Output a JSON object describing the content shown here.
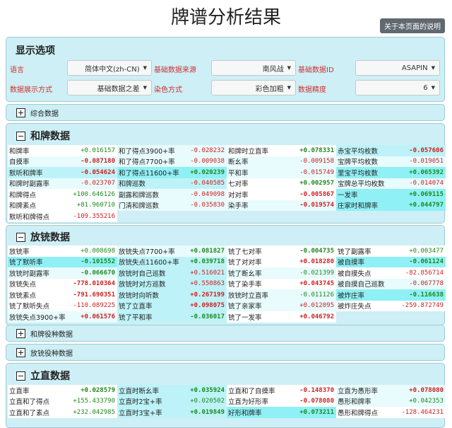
{
  "title": "牌谱分析结果",
  "help_button": "关于本页面的说明",
  "options": {
    "header": "显示选项",
    "rows": [
      [
        {
          "label": "语言",
          "value": "简体中文(zh-CN)"
        },
        {
          "label": "基础数据来源",
          "value": "南风战"
        },
        {
          "label": "基础数据ID",
          "value": "ASAPIN"
        }
      ],
      [
        {
          "label": "数据展示方式",
          "value": "基础数据之差"
        },
        {
          "label": "染色方式",
          "value": "彩色加粗"
        },
        {
          "label": "数据精度",
          "value": "6"
        }
      ]
    ]
  },
  "collapsed": {
    "composite": "综合数据",
    "hule_dealer": "和牌役种数据",
    "fangchong_dealer": "放铳役种数据"
  },
  "sections": {
    "hule": {
      "header": "和牌数据",
      "rows": [
        [
          [
            "和牌率",
            "+0.016157",
            "pos",
            0,
            false
          ],
          [
            "和了得点3900+率",
            "-0.028232",
            "neg",
            1,
            false
          ],
          [
            "和牌时立直率",
            "+0.078331",
            "pos",
            0,
            true
          ],
          [
            "赤宝平均枚数",
            "-0.057606",
            "neg",
            2,
            true
          ]
        ],
        [
          [
            "自摸率",
            "-0.087180",
            "neg",
            1,
            true
          ],
          [
            "和了得点7700+率",
            "-0.009038",
            "neg",
            1,
            false
          ],
          [
            "断幺率",
            "-0.009158",
            "neg",
            1,
            false
          ],
          [
            "宝牌平均枚数",
            "-0.019051",
            "neg",
            1,
            false
          ]
        ],
        [
          [
            "默听和牌率",
            "-0.054624",
            "neg",
            2,
            true
          ],
          [
            "和了得点11600+率",
            "+0.020239",
            "pos",
            3,
            true
          ],
          [
            "平和率",
            "-0.015749",
            "neg",
            1,
            false
          ],
          [
            "里宝平均枚数",
            "+0.065392",
            "pos",
            3,
            true
          ]
        ],
        [
          [
            "和牌时副露率",
            "-0.023707",
            "neg",
            1,
            false
          ],
          [
            "和牌巡数",
            "-0.040585",
            "neg",
            2,
            false
          ],
          [
            "七对率",
            "+0.002957",
            "pos",
            0,
            true
          ],
          [
            "宝牌总平均枚数",
            "-0.014074",
            "neg",
            1,
            false
          ]
        ],
        [
          [
            "和牌得点",
            "+100.646126",
            "pos",
            0,
            false
          ],
          [
            "副露和牌巡数",
            "-0.049098",
            "neg",
            1,
            false
          ],
          [
            "对对率",
            "-0.005867",
            "neg",
            0,
            true
          ],
          [
            "一发率",
            "+0.069115",
            "pos",
            3,
            true
          ]
        ],
        [
          [
            "和牌素点",
            "+81.960710",
            "pos",
            0,
            false
          ],
          [
            "门清和牌巡数",
            "-0.035830",
            "neg",
            1,
            false
          ],
          [
            "染手率",
            "-0.019574",
            "neg",
            1,
            true
          ],
          [
            "庄家时和牌率",
            "+0.044797",
            "pos",
            3,
            true
          ]
        ],
        [
          [
            "默听和牌得点",
            "-109.355216",
            "neg",
            0,
            false
          ]
        ]
      ]
    },
    "fangchong": {
      "header": "放铳数据",
      "rows": [
        [
          [
            "放铳率",
            "+0.008698",
            "pos",
            0,
            false
          ],
          [
            "放铳失点7700+率",
            "+0.081827",
            "pos",
            1,
            true
          ],
          [
            "铳了七对率",
            "-0.004735",
            "pos",
            0,
            true
          ],
          [
            "铳了副露率",
            "+0.003477",
            "pos",
            0,
            false
          ]
        ],
        [
          [
            "铳了默听率",
            "-0.101552",
            "pos",
            3,
            true
          ],
          [
            "放铳失点11600+率",
            "+0.039718",
            "pos",
            2,
            true
          ],
          [
            "铳了对对率",
            "+0.018280",
            "neg",
            0,
            true
          ],
          [
            "被自摸率",
            "-0.061124",
            "pos",
            3,
            true
          ]
        ],
        [
          [
            "放铳时副露率",
            "-0.066670",
            "pos",
            1,
            true
          ],
          [
            "放铳时自己巡数",
            "+0.516021",
            "neg",
            2,
            false
          ],
          [
            "铳了断幺率",
            "-0.021399",
            "pos",
            1,
            false
          ],
          [
            "被自摸失点",
            "-82.856714",
            "neg",
            0,
            false
          ]
        ],
        [
          [
            "放铳失点",
            "-778.010364",
            "neg",
            0,
            true
          ],
          [
            "放铳时对方巡数",
            "+0.550863",
            "neg",
            2,
            false
          ],
          [
            "铳了染手率",
            "+0.043745",
            "neg",
            0,
            true
          ],
          [
            "被自摸自己巡数",
            "-0.067778",
            "neg",
            1,
            false
          ]
        ],
        [
          [
            "放铳素点",
            "-791.690351",
            "neg",
            0,
            true
          ],
          [
            "放铳时向听数",
            "+0.267199",
            "neg",
            2,
            true
          ],
          [
            "放铳时立直率",
            "-0.011126",
            "pos",
            1,
            false
          ],
          [
            "被炸庄率",
            "-0.116638",
            "pos",
            3,
            true
          ]
        ],
        [
          [
            "铳了默听失点",
            "-110.089225",
            "neg",
            0,
            false
          ],
          [
            "铳了立直率",
            "+0.098075",
            "neg",
            2,
            true
          ],
          [
            "铳了亲家率",
            "+0.012095",
            "neg",
            1,
            false
          ],
          [
            "被炸庄失点",
            "-259.872749",
            "neg",
            0,
            false
          ]
        ],
        [
          [
            "放铳失点3900+率",
            "+0.061576",
            "neg",
            1,
            true
          ],
          [
            "铳了平和率",
            "-0.036017",
            "pos",
            2,
            true
          ],
          [
            "铳了一发率",
            "+0.046792",
            "neg",
            0,
            true
          ]
        ]
      ]
    },
    "lizhi": {
      "header": "立直数据",
      "rows": [
        [
          [
            "立直率",
            "+0.028579",
            "pos",
            0,
            true
          ],
          [
            "立直时断幺率",
            "+0.035924",
            "pos",
            2,
            true
          ],
          [
            "立直和了自摸率",
            "-0.148370",
            "neg",
            0,
            true
          ],
          [
            "立直为愚形率",
            "+0.078080",
            "neg",
            1,
            true
          ]
        ],
        [
          [
            "立直和了得点",
            "+155.433790",
            "pos",
            0,
            false
          ],
          [
            "立直时2宝+率",
            "+0.020502",
            "pos",
            2,
            false
          ],
          [
            "立直为好形率",
            "-0.078080",
            "neg",
            0,
            true
          ],
          [
            "愚形和牌率",
            "+0.042353",
            "pos",
            1,
            false
          ]
        ],
        [
          [
            "立直和了素点",
            "+232.042985",
            "pos",
            0,
            false
          ],
          [
            "立直时3宝+率",
            "+0.019849",
            "pos",
            2,
            true
          ],
          [
            "好形和牌率",
            "+0.073211",
            "pos",
            3,
            true
          ],
          [
            "愚形和牌得点",
            "-128.464231",
            "neg",
            0,
            false
          ]
        ]
      ]
    }
  }
}
